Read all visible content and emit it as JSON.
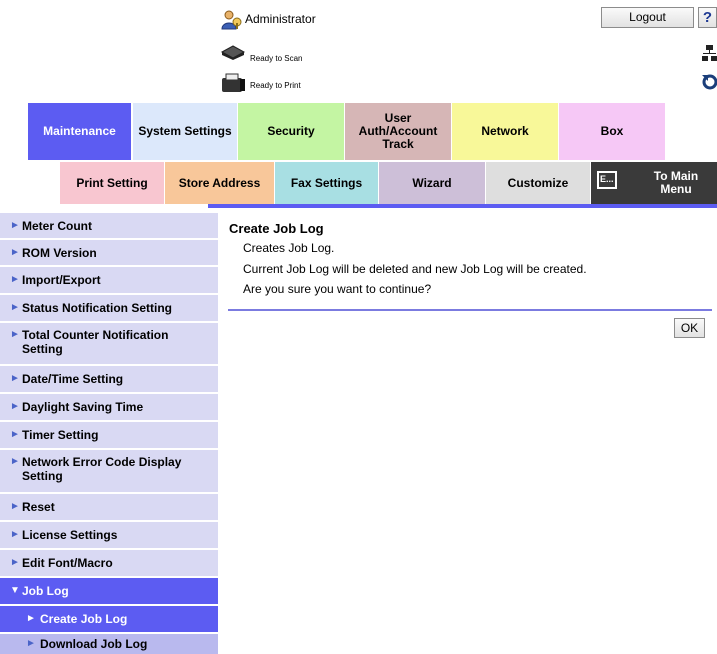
{
  "header": {
    "user_label": "Administrator",
    "logout_label": "Logout",
    "help_label": "?",
    "scan_status": "Ready to Scan",
    "print_status": "Ready to Print"
  },
  "tabs_row1": [
    {
      "label": "Maintenance",
      "color": "#5c5cf2",
      "active": true
    },
    {
      "label": "System Settings",
      "color": "#dce8fb"
    },
    {
      "label": "Security",
      "color": "#c4f5a3"
    },
    {
      "label": "User Auth/Account Track",
      "color": "#d6b6b6"
    },
    {
      "label": "Network",
      "color": "#f8f899"
    },
    {
      "label": "Box",
      "color": "#f6c8f6"
    }
  ],
  "tabs_row2": [
    {
      "label": "Print Setting",
      "color": "#f8c6d0"
    },
    {
      "label": "Store Address",
      "color": "#f8c79a"
    },
    {
      "label": "Fax Settings",
      "color": "#a8dfe3"
    },
    {
      "label": "Wizard",
      "color": "#cdbfd8"
    },
    {
      "label": "Customize",
      "color": "#dedede"
    },
    {
      "label": "To Main Menu",
      "color": "#3a3a3a"
    }
  ],
  "sidebar": {
    "items": [
      {
        "label": "Meter Count"
      },
      {
        "label": "ROM Version"
      },
      {
        "label": "Import/Export"
      },
      {
        "label": "Status Notification Setting"
      },
      {
        "label": "Total Counter Notification Setting"
      },
      {
        "label": "Date/Time Setting"
      },
      {
        "label": "Daylight Saving Time"
      },
      {
        "label": "Timer Setting"
      },
      {
        "label": "Network Error Code Display Setting"
      },
      {
        "label": "Reset"
      },
      {
        "label": "License Settings"
      },
      {
        "label": "Edit Font/Macro"
      },
      {
        "label": "Job Log"
      },
      {
        "label": "Create Job Log"
      },
      {
        "label": "Download Job Log"
      }
    ]
  },
  "main": {
    "title": "Create Job Log",
    "lines": [
      "Creates Job Log.",
      "Current Job Log will be deleted and new Job Log will be created.",
      "Are you sure you want to continue?"
    ],
    "ok_label": "OK"
  },
  "colors": {
    "accent": "#5c5cf2",
    "sidebar_bg": "#d9d9f3",
    "sidebar_sub_bg": "#b9b9ee"
  }
}
